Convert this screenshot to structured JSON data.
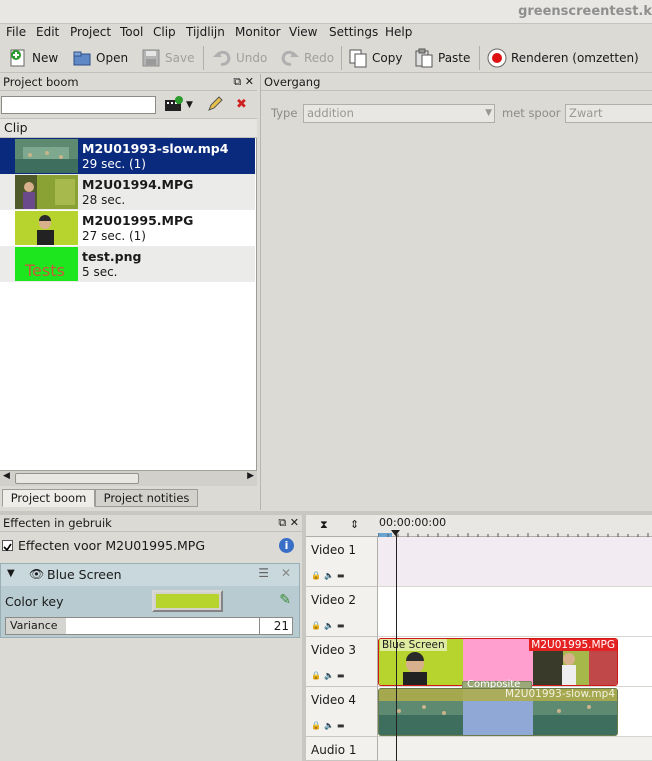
{
  "window": {
    "title": "greenscreentest.k"
  },
  "menu": [
    "File",
    "Edit",
    "Project",
    "Tool",
    "Clip",
    "Tijdlijn",
    "Monitor",
    "View",
    "Settings",
    "Help"
  ],
  "toolbar": {
    "new_label": "New",
    "open_label": "Open",
    "save_label": "Save",
    "undo_label": "Undo",
    "redo_label": "Redo",
    "copy_label": "Copy",
    "paste_label": "Paste",
    "render_label": "Renderen (omzetten)"
  },
  "project_tree": {
    "title": "Project boom",
    "search_placeholder": "",
    "column_header": "Clip",
    "clips": [
      {
        "name": "M2U01993-slow.mp4",
        "meta": "29 sec. (1)",
        "selected": true
      },
      {
        "name": "M2U01994.MPG",
        "meta": "28 sec.",
        "selected": false
      },
      {
        "name": "M2U01995.MPG",
        "meta": "27 sec. (1)",
        "selected": false
      },
      {
        "name": "test.png",
        "meta": "5 sec.",
        "selected": false,
        "thumb_text": "Tests"
      }
    ],
    "tabs": [
      "Project boom",
      "Project notities"
    ]
  },
  "transition": {
    "title": "Overgang",
    "type_label": "Type",
    "type_value": "addition",
    "track_label": "met spoor",
    "track_value": "Zwart"
  },
  "effects": {
    "title": "Effecten in gebruik",
    "target_label": "Effecten voor M2U01995.MPG",
    "effect_name": "Blue Screen",
    "color_key_label": "Color key",
    "color_key_value": "#b6d32e",
    "variance_label": "Variance",
    "variance_value": "21",
    "variance_fraction": 0.21
  },
  "timeline": {
    "timecode": "00:00:00:00",
    "tracks": [
      "Video 1",
      "Video 2",
      "Video 3",
      "Video 4",
      "Audio 1"
    ],
    "clip_v3_effect": "Blue Screen",
    "clip_v3_name": "M2U01995.MPG",
    "clip_v4_transition": "Composite",
    "clip_v4_name": "M2U01993-slow.mp4"
  },
  "colors": {
    "selection": "#0a2a7e",
    "green_screen": "#b6d32e",
    "clip_red": "#e52222"
  }
}
